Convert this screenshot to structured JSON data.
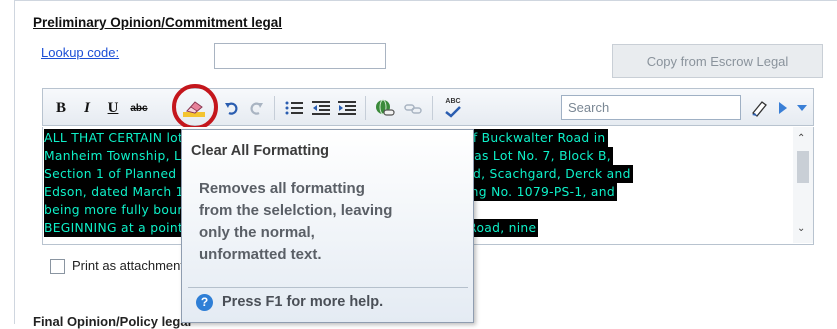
{
  "section": {
    "title": "Preliminary Opinion/Commitment legal",
    "lookup_label": "Lookup code:",
    "lookup_value": "",
    "copy_button": "Copy from Escrow Legal"
  },
  "toolbar": {
    "bold": "B",
    "italic": "I",
    "underline": "U",
    "strike": "abc",
    "spell": "ABC",
    "search_placeholder": "Search",
    "icons": [
      "bold-icon",
      "italic-icon",
      "underline-icon",
      "strikethrough-icon",
      "clear-formatting-icon",
      "undo-icon",
      "redo-icon",
      "bulleted-list-icon",
      "decrease-indent-icon",
      "increase-indent-icon",
      "insert-link-icon",
      "remove-link-icon",
      "spell-check-icon",
      "search-icon",
      "highlighter-icon",
      "play-icon",
      "dropdown-icon"
    ]
  },
  "editor": {
    "lines": [
      "ALL THAT CERTAIN lot or piece of land situated on the south side of Buckwalter Road in",
      "Manheim Township, Lancaster County, Pennsylvania, being known as Lot No. 7, Block B,",
      "Section 1 of Planned Residential Development prepared by Mccloud, Scachgard, Derck and",
      "Edson, dated March 14, 1979 and last revised June 7, 1979, Drawing No. 1079-PS-1, and",
      "being more fully bounded and described as follows:",
      "BEGINNING at a point on the southern right-of-way of Buckwalter Road, nine"
    ]
  },
  "print_option": {
    "label": "Print as attachment",
    "checked": false
  },
  "final_section": {
    "title": "Final Opinion/Policy legal"
  },
  "tooltip": {
    "title": "Clear All Formatting",
    "body": "Removes all formatting\nfrom the selelction, leaving\nonly the normal,\nunformatted text.",
    "help": "Press F1 for more help."
  },
  "colors": {
    "highlight_bg": "#000000",
    "highlight_text": "#0ef0c8",
    "callout_circle": "#c4161c",
    "link": "#1c4fd6"
  }
}
